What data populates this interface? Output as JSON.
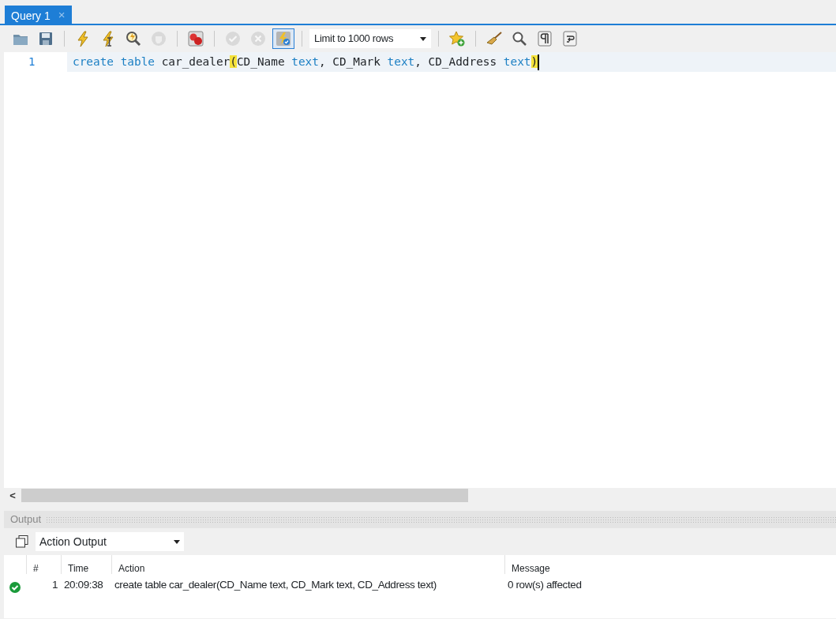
{
  "tabs": [
    {
      "label": "Query 1",
      "close": "×",
      "selected": true
    }
  ],
  "toolbar": {
    "groups": [
      [
        {
          "kind": "folder",
          "disabled": false
        },
        {
          "kind": "save",
          "disabled": false
        }
      ],
      [
        {
          "kind": "bolt",
          "disabled": false
        },
        {
          "kind": "bolt-cursor",
          "disabled": false
        },
        {
          "kind": "explain",
          "disabled": false
        },
        {
          "kind": "stop",
          "disabled": true
        }
      ],
      [
        {
          "kind": "error-toggle",
          "disabled": false
        }
      ],
      [
        {
          "kind": "commit",
          "disabled": true
        },
        {
          "kind": "rollback",
          "disabled": true
        },
        {
          "kind": "autocommit",
          "disabled": false,
          "on": true
        }
      ],
      [
        {
          "kind": "limit",
          "value": "Limit to 1000 rows"
        }
      ],
      [
        {
          "kind": "star",
          "disabled": false
        }
      ],
      [
        {
          "kind": "broom",
          "disabled": false
        },
        {
          "kind": "search",
          "disabled": false
        },
        {
          "kind": "pilcrow",
          "disabled": false
        },
        {
          "kind": "wrap",
          "disabled": false
        }
      ]
    ]
  },
  "editor": {
    "lines": [
      {
        "number": "1",
        "tokens": [
          {
            "kind": "keyword",
            "text": "create "
          },
          {
            "kind": "keyword",
            "text": "table "
          },
          {
            "kind": "ident",
            "text": "car_dealer"
          },
          {
            "kind": "bracket",
            "text": "("
          },
          {
            "kind": "ident",
            "text": "CD_Name "
          },
          {
            "kind": "keyword",
            "text": "text"
          },
          {
            "kind": "ident",
            "text": ", CD_Mark "
          },
          {
            "kind": "keyword",
            "text": "text"
          },
          {
            "kind": "ident",
            "text": ", CD_Address "
          },
          {
            "kind": "keyword",
            "text": "text"
          },
          {
            "kind": "bracket",
            "text": ")"
          }
        ]
      }
    ]
  },
  "scroll_left": "<",
  "output": {
    "title": "Output",
    "selector": "Action Output",
    "columns": [
      "#",
      "Time",
      "Action",
      "Message"
    ],
    "rows": [
      {
        "success": true,
        "number": "1",
        "time": "20:09:38",
        "action": "create table car_dealer(CD_Name text, CD_Mark text, CD_Address text)",
        "message": "0 row(s) affected"
      }
    ]
  }
}
